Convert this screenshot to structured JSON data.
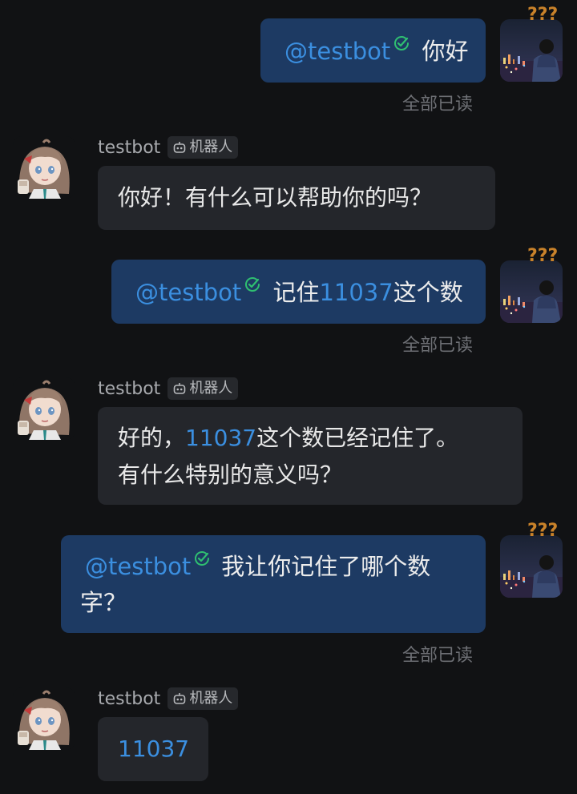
{
  "messages": [
    {
      "mention": "@testbot",
      "text": "你好",
      "status": "全部已读"
    },
    {
      "sender": "testbot",
      "badge": "机器人",
      "text": "你好！有什么可以帮助你的吗？"
    },
    {
      "mention": "@testbot",
      "text_before": "记住",
      "number": "11037",
      "text_after": "这个数",
      "status": "全部已读"
    },
    {
      "sender": "testbot",
      "badge": "机器人",
      "text_before": "好的，",
      "number": "11037",
      "text_after": "这个数已经记住了。",
      "line2": "有什么特别的意义吗？"
    },
    {
      "mention": "@testbot",
      "text": "我让你记住了哪个数",
      "line2": "字？",
      "status": "全部已读"
    },
    {
      "sender": "testbot",
      "badge": "机器人",
      "number": "11037"
    }
  ],
  "user_avatar_decoration": "???",
  "colors": {
    "background": "#111214",
    "outgoing_bubble": "#1d3a63",
    "incoming_bubble": "#24262b",
    "link": "#3b8fe0",
    "verified": "#2fbf71"
  },
  "icons": {
    "verified": "check-badge-icon",
    "bot": "robot-icon"
  }
}
